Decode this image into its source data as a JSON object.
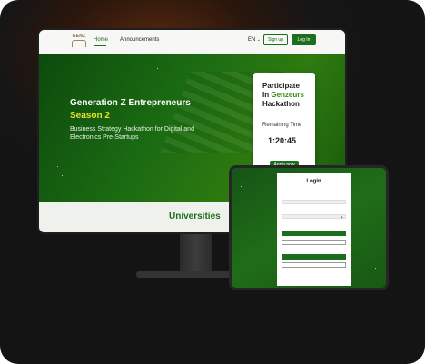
{
  "monitor": {
    "nav": {
      "logo_text": "GENZ",
      "home": "Home",
      "announcements": "Announcements",
      "language": "EN",
      "signup": "Sign up",
      "login": "Log In"
    },
    "hero": {
      "title": "Generation Z Entrepreneurs",
      "season": "Season 2",
      "subtitle": "Business Strategy Hackathon for Digital and Electronics Pre-Startups"
    },
    "countdown": {
      "line1": "Participate",
      "line2_prefix": "In ",
      "line2_highlight": "Genzeurs",
      "line3": "Hackathon",
      "remaining_label": "Remaining Time",
      "time": "1:20:45",
      "apply": "Apply now"
    },
    "section_title": "Universities"
  },
  "tablet": {
    "login": {
      "title": "Login"
    }
  },
  "colors": {
    "brand_green": "#1b6e1b",
    "highlight_yellow": "#e6e22a"
  }
}
